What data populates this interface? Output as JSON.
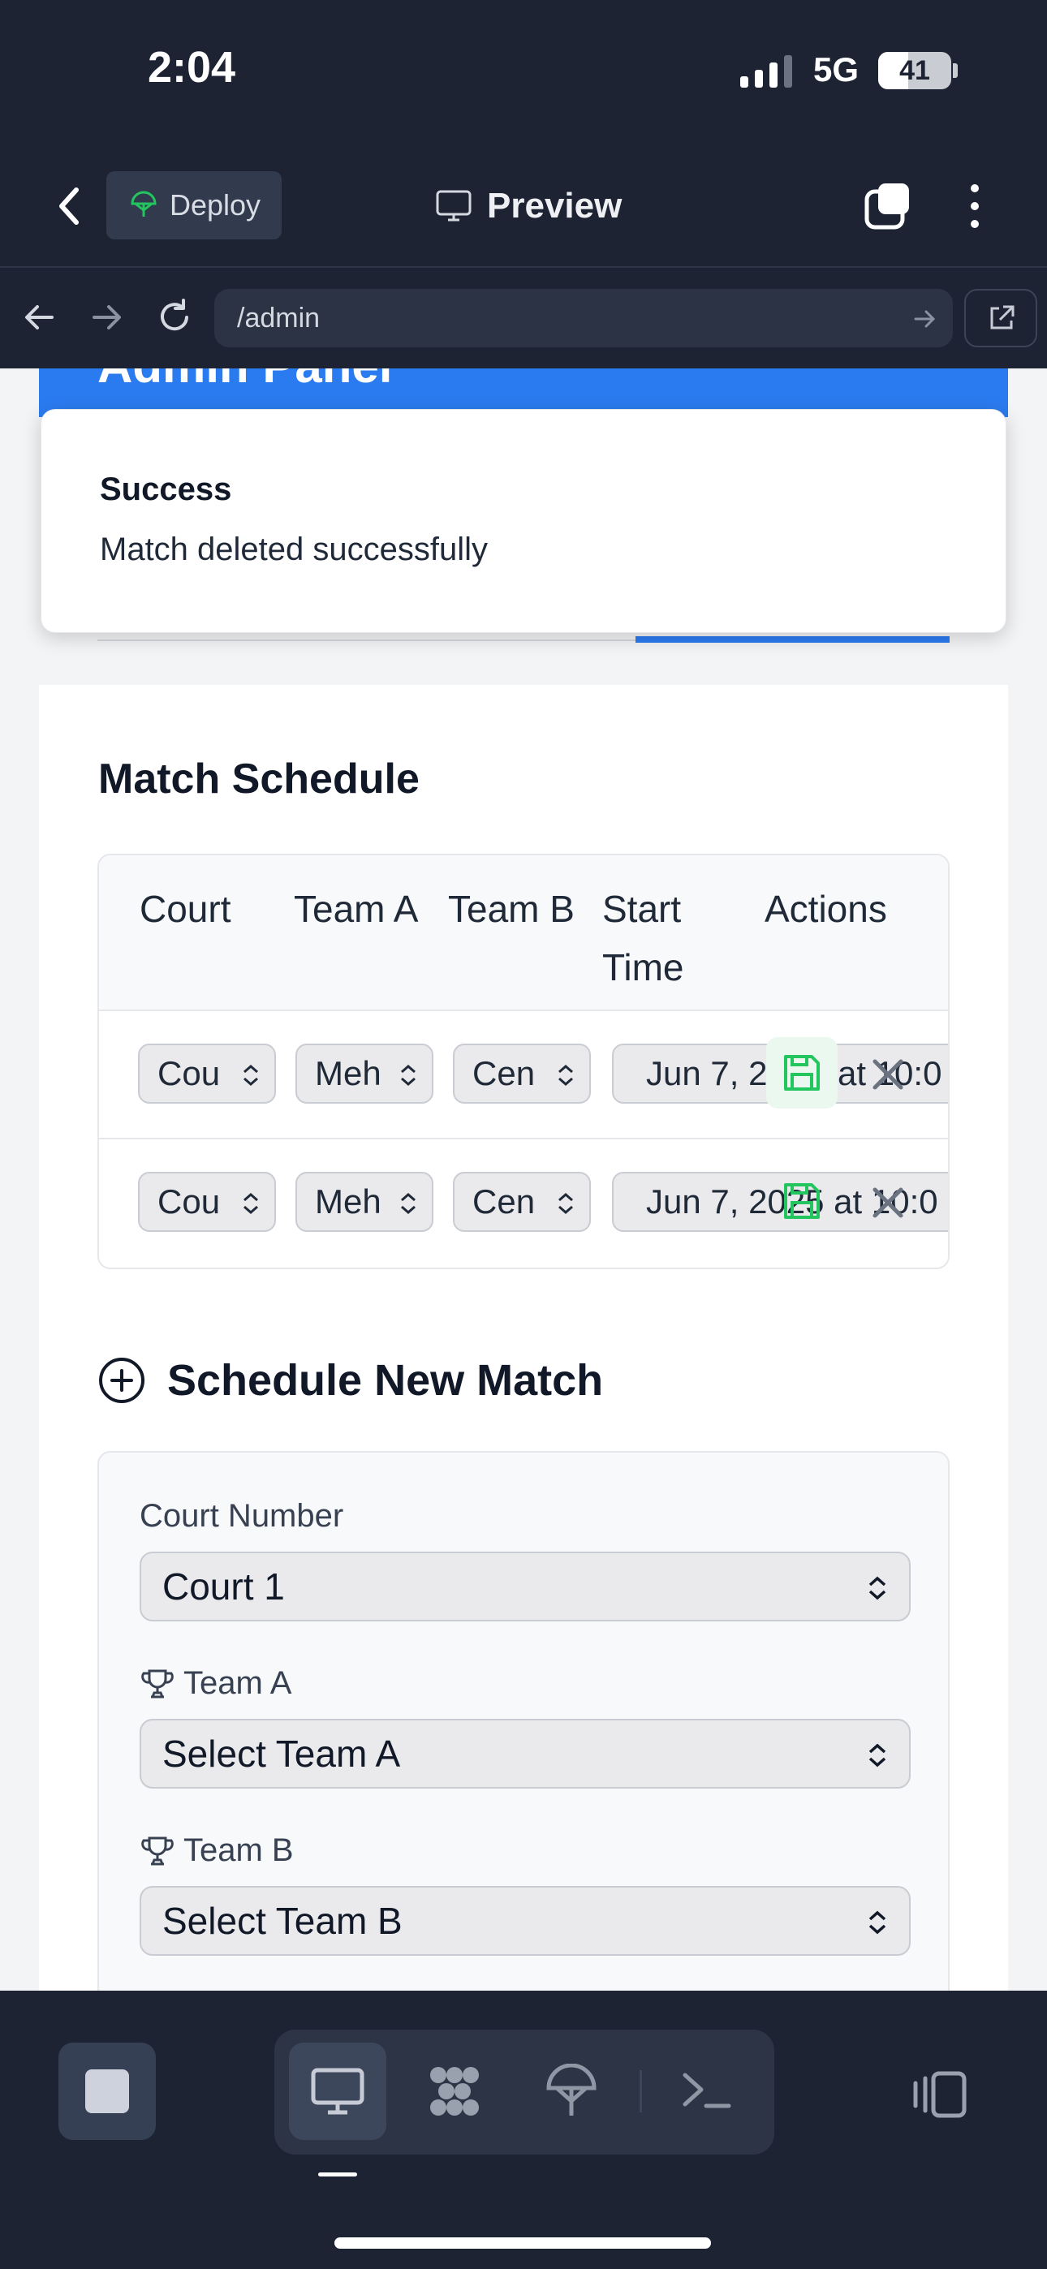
{
  "status_bar": {
    "time": "2:04",
    "network": "5G",
    "battery": "41"
  },
  "app_header": {
    "deploy_label": "Deploy",
    "preview_label": "Preview"
  },
  "browser": {
    "url": "/admin"
  },
  "page": {
    "header_title": "Admin Panel"
  },
  "toast": {
    "title": "Success",
    "message": "Match deleted successfully"
  },
  "schedule": {
    "title": "Match Schedule",
    "columns": [
      "Court",
      "Team A",
      "Team B",
      "Start Time",
      "Actions"
    ],
    "rows": [
      {
        "court": "Cou",
        "team_a": "Meh",
        "team_b": "Cen",
        "start": "Jun 7, 2",
        "start_tail": "at 10:0"
      },
      {
        "court": "Cou",
        "team_a": "Meh",
        "team_b": "Cen",
        "start": "Jun 7, 2025 at 10:0"
      }
    ]
  },
  "new_match": {
    "title": "Schedule New Match",
    "court_label": "Court Number",
    "court_value": "Court 1",
    "team_a_label": "Team A",
    "team_a_value": "Select Team A",
    "team_b_label": "Team B",
    "team_b_value": "Select Team B"
  },
  "colors": {
    "accent": "#2b7bf0",
    "save_green": "#22c55e",
    "dark_bg": "#1d2333"
  }
}
